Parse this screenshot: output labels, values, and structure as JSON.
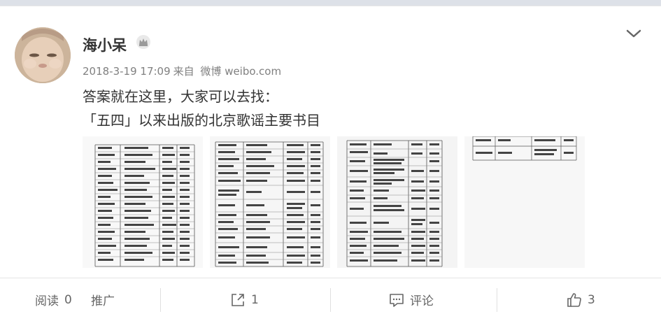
{
  "user": {
    "name": "海小呆",
    "badge_icon": "crown-icon"
  },
  "meta": {
    "timestamp": "2018-3-19 17:09",
    "source_prefix": "来自",
    "source": "微博 weibo.com"
  },
  "post": {
    "line1": "答案就在这里，大家可以去找：",
    "line2": "「五四」以来出版的北京歌谣主要书目"
  },
  "images": [
    {
      "alt": "图片1"
    },
    {
      "alt": "图片2"
    },
    {
      "alt": "图片3"
    },
    {
      "alt": "图片4"
    }
  ],
  "toolbar": {
    "reads_label": "阅读",
    "reads_count": "0",
    "promote_label": "推广",
    "share_count": "1",
    "comment_label": "评论",
    "like_count": "3"
  },
  "colors": {
    "text": "#333333",
    "meta": "#808080",
    "border": "#e4e4e4"
  }
}
